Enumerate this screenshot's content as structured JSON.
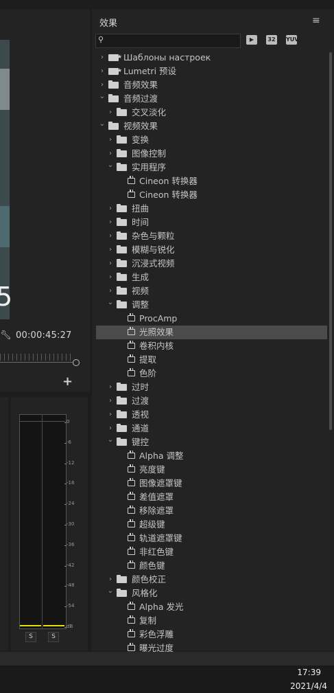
{
  "preview": {
    "timecode": "00:00:45:27",
    "overlay_char": "5",
    "add_symbol": "+"
  },
  "audio_meter": {
    "scale": [
      "0",
      "-6",
      "-12",
      "-18",
      "-24",
      "-30",
      "-36",
      "-42",
      "-48",
      "-54",
      "dB"
    ],
    "solo_left": "S",
    "solo_right": "S"
  },
  "effects_panel": {
    "title": "效果",
    "menu_icon": "≡",
    "search": {
      "value": "",
      "placeholder": ""
    },
    "filter_buttons": [
      "32",
      "YUV"
    ],
    "items": [
      {
        "label": "Шаблоны настроек",
        "depth": 0,
        "kind": "preset-folder",
        "expanded": false
      },
      {
        "label": "Lumetri 预设",
        "depth": 0,
        "kind": "preset-folder",
        "expanded": false
      },
      {
        "label": "音频效果",
        "depth": 0,
        "kind": "folder",
        "expanded": false
      },
      {
        "label": "音频过渡",
        "depth": 0,
        "kind": "folder",
        "expanded": true
      },
      {
        "label": "交叉淡化",
        "depth": 1,
        "kind": "folder",
        "expanded": false
      },
      {
        "label": "视频效果",
        "depth": 0,
        "kind": "folder",
        "expanded": true
      },
      {
        "label": "变换",
        "depth": 1,
        "kind": "folder",
        "expanded": false
      },
      {
        "label": "图像控制",
        "depth": 1,
        "kind": "folder",
        "expanded": false
      },
      {
        "label": "实用程序",
        "depth": 1,
        "kind": "folder",
        "expanded": true
      },
      {
        "label": "Cineon 转换器",
        "depth": 2,
        "kind": "effect"
      },
      {
        "label": "Cineon 转换器",
        "depth": 2,
        "kind": "effect"
      },
      {
        "label": "扭曲",
        "depth": 1,
        "kind": "folder",
        "expanded": false
      },
      {
        "label": "时间",
        "depth": 1,
        "kind": "folder",
        "expanded": false
      },
      {
        "label": "杂色与颗粒",
        "depth": 1,
        "kind": "folder",
        "expanded": false
      },
      {
        "label": "模糊与锐化",
        "depth": 1,
        "kind": "folder",
        "expanded": false
      },
      {
        "label": "沉浸式视频",
        "depth": 1,
        "kind": "folder",
        "expanded": false
      },
      {
        "label": "生成",
        "depth": 1,
        "kind": "folder",
        "expanded": false
      },
      {
        "label": "视频",
        "depth": 1,
        "kind": "folder",
        "expanded": false
      },
      {
        "label": "调整",
        "depth": 1,
        "kind": "folder",
        "expanded": true
      },
      {
        "label": "ProcAmp",
        "depth": 2,
        "kind": "effect"
      },
      {
        "label": "光照效果",
        "depth": 2,
        "kind": "effect",
        "selected": true
      },
      {
        "label": "卷积内核",
        "depth": 2,
        "kind": "effect"
      },
      {
        "label": "提取",
        "depth": 2,
        "kind": "effect"
      },
      {
        "label": "色阶",
        "depth": 2,
        "kind": "effect"
      },
      {
        "label": "过时",
        "depth": 1,
        "kind": "folder",
        "expanded": false
      },
      {
        "label": "过渡",
        "depth": 1,
        "kind": "folder",
        "expanded": false
      },
      {
        "label": "透视",
        "depth": 1,
        "kind": "folder",
        "expanded": false
      },
      {
        "label": "通道",
        "depth": 1,
        "kind": "folder",
        "expanded": false
      },
      {
        "label": "键控",
        "depth": 1,
        "kind": "folder",
        "expanded": true
      },
      {
        "label": "Alpha 调整",
        "depth": 2,
        "kind": "effect"
      },
      {
        "label": "亮度键",
        "depth": 2,
        "kind": "effect"
      },
      {
        "label": "图像遮罩键",
        "depth": 2,
        "kind": "effect"
      },
      {
        "label": "差值遮罩",
        "depth": 2,
        "kind": "effect"
      },
      {
        "label": "移除遮罩",
        "depth": 2,
        "kind": "effect"
      },
      {
        "label": "超级键",
        "depth": 2,
        "kind": "effect"
      },
      {
        "label": "轨道遮罩键",
        "depth": 2,
        "kind": "effect"
      },
      {
        "label": "非红色键",
        "depth": 2,
        "kind": "effect"
      },
      {
        "label": "颜色键",
        "depth": 2,
        "kind": "effect"
      },
      {
        "label": "颜色校正",
        "depth": 1,
        "kind": "folder",
        "expanded": false
      },
      {
        "label": "风格化",
        "depth": 1,
        "kind": "folder",
        "expanded": true
      },
      {
        "label": "Alpha 发光",
        "depth": 2,
        "kind": "effect"
      },
      {
        "label": "复制",
        "depth": 2,
        "kind": "effect"
      },
      {
        "label": "彩色浮雕",
        "depth": 2,
        "kind": "effect"
      },
      {
        "label": "曝光过度",
        "depth": 2,
        "kind": "effect"
      }
    ]
  },
  "taskbar": {
    "time": "17:39",
    "date": "2021/4/4"
  },
  "colors": {
    "panel_bg": "#232323",
    "selection_bg": "#4b4b4b",
    "meter_level": "#e6e000"
  }
}
